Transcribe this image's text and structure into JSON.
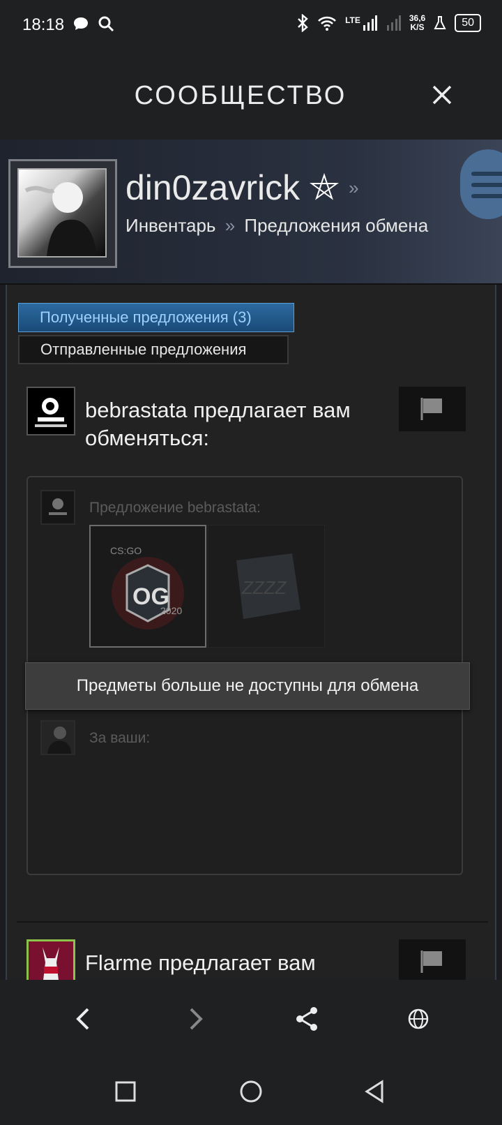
{
  "status_bar": {
    "time": "18:18",
    "network": "LTE",
    "speed_value": "36,6",
    "speed_unit": "K/S",
    "battery": "50"
  },
  "header": {
    "title": "СООБЩЕСТВО"
  },
  "profile": {
    "username": "din0zavrick",
    "username_sep": "»",
    "breadcrumb_inventory": "Инвентарь",
    "breadcrumb_sep": "»",
    "breadcrumb_offers": "Предложения обмена"
  },
  "tabs": {
    "received": "Полученные предложения (3)",
    "sent": "Отправленные предложения"
  },
  "offers": [
    {
      "title": "bebrastata предлагает вам обменяться:",
      "their_label": "Предложение bebrastata:",
      "your_label": "За ваши:",
      "unavailable_message": "Предметы больше не доступны для обмена",
      "items": [
        "CS:GO OG 2020 sticker",
        "graffiti item"
      ]
    },
    {
      "title": "Flarme предлагает вам"
    }
  ],
  "colors": {
    "accent": "#2c6aa0",
    "accent_text": "#9ed0ff",
    "background": "#222222"
  }
}
